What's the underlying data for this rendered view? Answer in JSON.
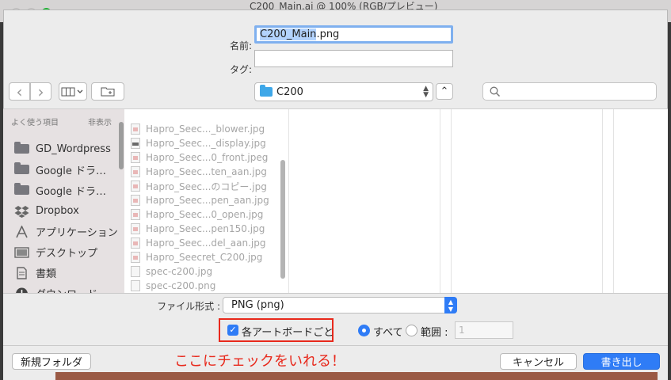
{
  "window": {
    "title": "C200_Main.ai @ 100% (RGB/プレビュー)"
  },
  "save": {
    "name_label": "名前:",
    "name_selected": "C200_Main",
    "name_ext": ".png",
    "tag_label": "タグ:",
    "tag_value": ""
  },
  "toolbar": {
    "back_glyph": "‹",
    "forward_glyph": "›",
    "location": "C200",
    "up_glyph": "⌃"
  },
  "sidebar": {
    "section_title": "よく使う項目",
    "hide_label": "非表示",
    "items": [
      {
        "label": "GD_Wordpress",
        "icon": "folder-icon"
      },
      {
        "label": "Google ドラ…",
        "icon": "folder-icon"
      },
      {
        "label": "Google ドラ…",
        "icon": "folder-icon"
      },
      {
        "label": "Dropbox",
        "icon": "dropbox-icon"
      },
      {
        "label": "アプリケーション",
        "icon": "applications-icon"
      },
      {
        "label": "デスクトップ",
        "icon": "desktop-icon"
      },
      {
        "label": "書類",
        "icon": "documents-icon"
      },
      {
        "label": "ダウンロード",
        "icon": "download-icon"
      }
    ]
  },
  "files": [
    {
      "name": "Hapro_Seec..._blower.jpg",
      "icon": "img"
    },
    {
      "name": "Hapro_Seec..._display.jpg",
      "icon": "dark"
    },
    {
      "name": "Hapro_Seec...0_front.jpeg",
      "icon": "img"
    },
    {
      "name": "Hapro_Seec...ten_aan.jpg",
      "icon": "img"
    },
    {
      "name": "Hapro_Seec...のコピー.jpg",
      "icon": "img"
    },
    {
      "name": "Hapro_Seec...pen_aan.jpg",
      "icon": "img"
    },
    {
      "name": "Hapro_Seec...0_open.jpg",
      "icon": "img"
    },
    {
      "name": "Hapro_Seec...pen150.jpg",
      "icon": "img"
    },
    {
      "name": "Hapro_Seec...del_aan.jpg",
      "icon": "img"
    },
    {
      "name": "Hapro_Seecret_C200.jpg",
      "icon": "img"
    },
    {
      "name": "spec-c200.jpg",
      "icon": "plain"
    },
    {
      "name": "spec-c200.png",
      "icon": "plain"
    }
  ],
  "options": {
    "format_label": "ファイル形式 :",
    "format_value": "PNG (png)",
    "artboard_label": "各アートボードごと",
    "all_label": "すべて",
    "range_label": "範囲 :",
    "range_value": "1"
  },
  "buttons": {
    "new_folder": "新規フォルダ",
    "cancel": "キャンセル",
    "export": "書き出し"
  },
  "annotation": "ここにチェックをいれる！",
  "colors": {
    "accent": "#2f7cf6",
    "highlight": "#e8291c",
    "close_light": "#2ac840"
  }
}
